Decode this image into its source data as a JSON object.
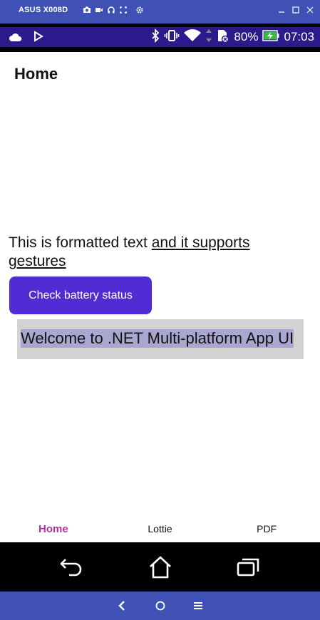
{
  "window": {
    "title": "ASUS X008D",
    "tools": [
      "camera-icon",
      "video-icon",
      "headphones-icon",
      "fullscreen-icon",
      "settings-icon"
    ],
    "controls": [
      "minimize-icon",
      "maximize-icon",
      "close-icon"
    ]
  },
  "status_bar": {
    "left_icons": [
      "cloud-icon",
      "play-store-icon"
    ],
    "right_icons": [
      "bluetooth-icon",
      "vibrate-icon",
      "wifi-icon",
      "data-arrows-icon",
      "no-sim-icon"
    ],
    "battery_percent": "80%",
    "time": "07:03",
    "background": "#2b1a8c"
  },
  "app": {
    "title": "Home",
    "formatted_text": {
      "plain": "This is formatted text ",
      "link": "and it supports gestures"
    },
    "battery_button": "Check battery status",
    "welcome": "Welcome to .NET Multi-platform App UI",
    "accent": "#512bd4"
  },
  "tabs": [
    {
      "label": "Home",
      "active": true
    },
    {
      "label": "Lottie",
      "active": false
    },
    {
      "label": "PDF",
      "active": false
    }
  ],
  "nav_bar": [
    "back-icon",
    "home-icon",
    "recents-icon"
  ],
  "emulator_bottom": [
    "chevron-left-icon",
    "circle-icon",
    "menu-icon"
  ],
  "colors": {
    "frame": "#3f51b5",
    "active_tab": "#b5309c"
  }
}
